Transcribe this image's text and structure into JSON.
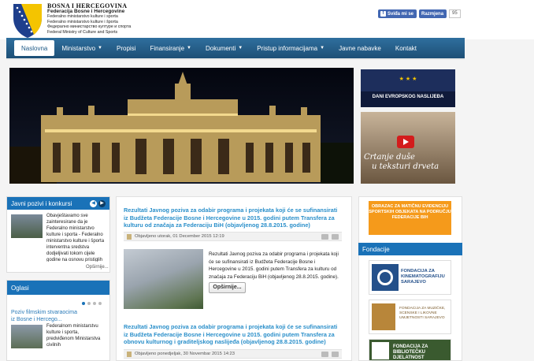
{
  "header": {
    "title": "BOSNA I HERCEGOVINA",
    "subtitle": "Federacija Bosne i Hercegovine",
    "lines": [
      "Federalno ministarstvo kulture i sporta",
      "Federalno ministarstvo kulture i športa",
      "Федерално министарство културе и спорта",
      "Federal Ministry of Culture and Sports"
    ]
  },
  "social": {
    "like": "Sviđa mi se",
    "share": "Razmjena",
    "count": "95"
  },
  "nav": [
    {
      "label": "Naslovna",
      "active": true,
      "dropdown": false
    },
    {
      "label": "Ministarstvo",
      "dropdown": true
    },
    {
      "label": "Propisi",
      "dropdown": false
    },
    {
      "label": "Finansiranje",
      "dropdown": true
    },
    {
      "label": "Dokumenti",
      "dropdown": true
    },
    {
      "label": "Pristup informacijama",
      "dropdown": true
    },
    {
      "label": "Javne nabavke",
      "dropdown": false
    },
    {
      "label": "Kontakt",
      "dropdown": false
    }
  ],
  "banners": {
    "days": "DANI EVROPSKOG NASLIJEĐA",
    "video_line1": "Crtanje duše",
    "video_line2": "u teksturi drveta"
  },
  "left": {
    "javni_title": "Javni pozivi i konkursi",
    "javni_text": "Obavještavamo sve zainteresirane da je Federalno ministarstvo kulture i sporta - Federalno ministarstvo kulture i športa interventna sredstva dodjeljivati tokom cijele godine na osnovu pristiglih zahtjeva koji ispunjavaju potrebne uvjete. Sredstva će se...",
    "javni_more": "Opširnije...",
    "oglasi_title": "Oglasi",
    "oglasi_link": "Poziv filmskim stvaraocima iz Bosne i Hercego...",
    "oglasi_text": "Federalnom ministarstvu kulture i sporta, predviđenom Ministarstva civilnih"
  },
  "articles": [
    {
      "title": "Rezultati Javnog poziva za odabir programa i projekata koji će se sufinansirati iz Budžeta Federacije Bosne i Hercegovine u 2015. godini putem Transfera za kulturu od značaja za Federaciju BiH (objavljenog 28.8.2015. godine)",
      "meta": "Objavljeno utorak, 01 December 2015 12:19",
      "body": "Rezultati Javnog poziva za odabir programa i projekata koji će se sufinansirati iz Budžeta Federacije Bosne i Hercegovine u 2015. godini putem Transfera za kulturu od značaja za Federaciju BiH (objavljenog 28.8.2015. godine).",
      "more": "Opširnije..."
    },
    {
      "title": "Rezultati Javnog poziva za odabir programa i projekata koji će se sufinansirati iz Budžeta Federacije Bosne i Hercegovine u 2015. godini putem Transfera za obnovu kulturnog i graditeljskog naslijeđa (objavljenog 28.8.2015. godine)",
      "meta": "Objavljeno ponedjeljak, 30 Novembar 2015 14:23"
    }
  ],
  "right": {
    "obrazac": "OBRAZAC ZA MATIČNU EVIDENCIJU SPORTSKIH OBJEKATA NA PODRUČJU FEDERACIJE BIH",
    "fondacije_title": "Fondacije",
    "fond1": "FONDACIJA ZA KINEMATOGRAFIJU SARAJEVO",
    "fond2": "FONDACIJA ZA MUZIČKE, SCENSKE I LIKOVNE UMJETNOSTI SARAJEVO",
    "fond3": "FONDACIJA ZA BIBLIOTEČKU DJELATNOST"
  },
  "colors": {
    "nav": "#1d4f76",
    "accent": "#1a72b8",
    "link": "#2a8fca",
    "orange": "#f59a1b"
  }
}
